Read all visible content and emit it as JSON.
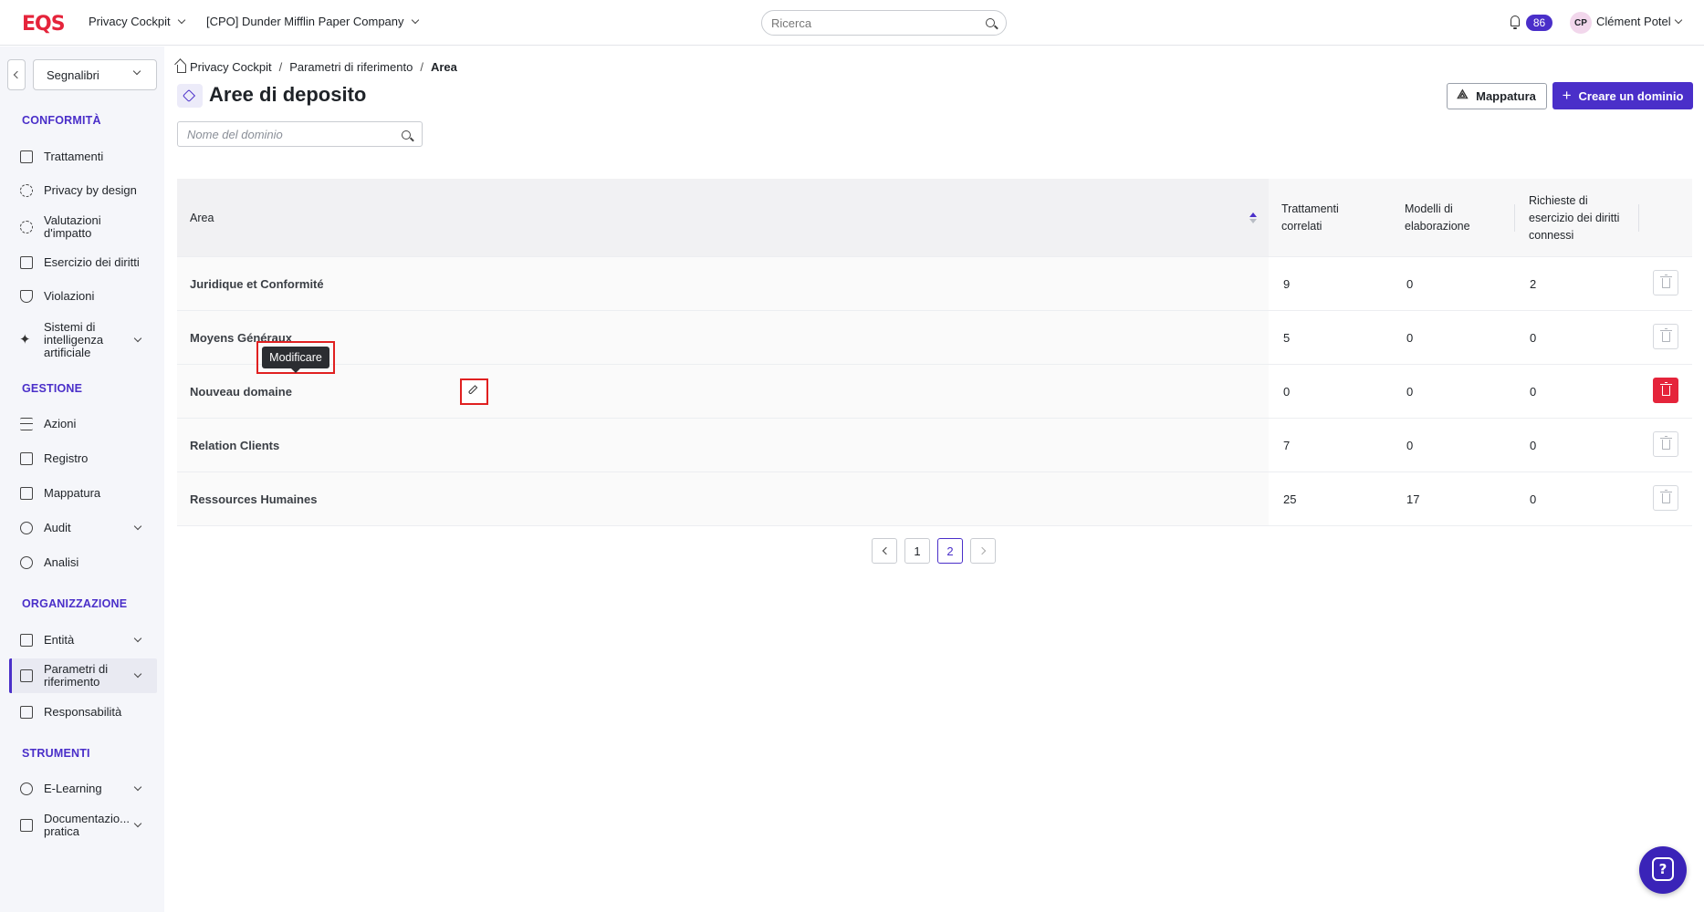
{
  "header": {
    "logo": "EQS",
    "app_name": "Privacy Cockpit",
    "company": "[CPO] Dunder Mifflin Paper Company",
    "search_placeholder": "Ricerca",
    "notifications_count": "86",
    "user_initials": "CP",
    "user_name": "Clément Potel"
  },
  "sidebar": {
    "bookmarks_label": "Segnalibri",
    "sections": {
      "conformita": "CONFORMITÀ",
      "gestione": "GESTIONE",
      "organizzazione": "ORGANIZZAZIONE",
      "strumenti": "STRUMENTI"
    },
    "items": {
      "trattamenti": "Trattamenti",
      "privacy_by_design": "Privacy by design",
      "valutazioni_line1": "Valutazioni",
      "valutazioni_line2": "d'impatto",
      "esercizio": "Esercizio dei diritti",
      "violazioni": "Violazioni",
      "ai_line1": "Sistemi di",
      "ai_line2": "intelligenza",
      "ai_line3": "artificiale",
      "azioni": "Azioni",
      "registro": "Registro",
      "mappatura": "Mappatura",
      "audit": "Audit",
      "analisi": "Analisi",
      "entita": "Entità",
      "parametri_line1": "Parametri di",
      "parametri_line2": "riferimento",
      "responsabilita": "Responsabilità",
      "elearning": "E-Learning",
      "doc_line1": "Documentazio...",
      "doc_line2": "pratica"
    }
  },
  "breadcrumb": {
    "home": "Privacy Cockpit",
    "parent": "Parametri di riferimento",
    "current": "Area"
  },
  "page": {
    "title": "Aree di deposito",
    "map_button": "Mappatura",
    "create_button": "Creare un dominio",
    "search_placeholder": "Nome del dominio"
  },
  "table": {
    "headers": {
      "area": "Area",
      "trattamenti_l1": "Trattamenti",
      "trattamenti_l2": "correlati",
      "modelli_l1": "Modelli di",
      "modelli_l2": "elaborazione",
      "richieste_l1": "Richieste di",
      "richieste_l2": "esercizio dei diritti",
      "richieste_l3": "connessi"
    },
    "rows": [
      {
        "area": "Juridique et Conformité",
        "trattamenti": "9",
        "modelli": "0",
        "richieste": "2"
      },
      {
        "area": "Moyens Généraux",
        "trattamenti": "5",
        "modelli": "0",
        "richieste": "0"
      },
      {
        "area": "Nouveau domaine",
        "trattamenti": "0",
        "modelli": "0",
        "richieste": "0"
      },
      {
        "area": "Relation Clients",
        "trattamenti": "7",
        "modelli": "0",
        "richieste": "0"
      },
      {
        "area": "Ressources Humaines",
        "trattamenti": "25",
        "modelli": "17",
        "richieste": "0"
      }
    ],
    "tooltip": "Modificare"
  },
  "pagination": {
    "pages": [
      "1",
      "2"
    ],
    "current": "2"
  },
  "colors": {
    "accent": "#4a2fc9",
    "danger": "#e5243b",
    "brand": "#e5243b"
  }
}
